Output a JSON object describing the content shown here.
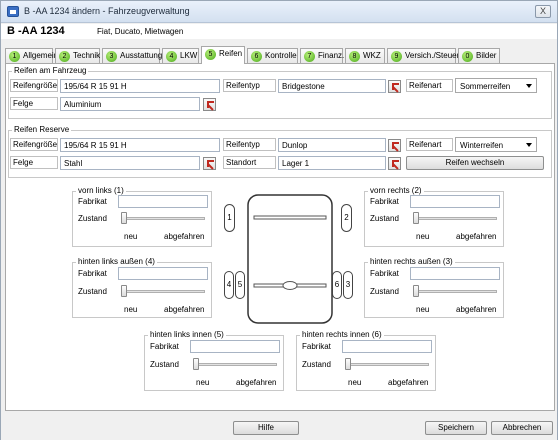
{
  "window": {
    "title": "B -AA 1234 ändern - Fahrzeugverwaltung",
    "close": "X"
  },
  "header": {
    "plate": "B -AA 1234",
    "description": "Fiat, Ducato, Mietwagen"
  },
  "tabs": [
    {
      "num": "1",
      "label": "Allgemein"
    },
    {
      "num": "2",
      "label": "Technik"
    },
    {
      "num": "3",
      "label": "Ausstattung"
    },
    {
      "num": "4",
      "label": "LKW"
    },
    {
      "num": "5",
      "label": "Reifen"
    },
    {
      "num": "6",
      "label": "Kontrolle"
    },
    {
      "num": "7",
      "label": "Finanz."
    },
    {
      "num": "8",
      "label": "WKZ"
    },
    {
      "num": "9",
      "label": "Versich./Steuer"
    },
    {
      "num": "0",
      "label": "Bilder"
    }
  ],
  "active_tab": "Reifen",
  "fahrzeug": {
    "group_title": "Reifen am Fahrzeug",
    "groesse_label": "Reifengröße",
    "groesse_value": "195/64 R 15 91 H",
    "typ_label": "Reifentyp",
    "typ_value": "Bridgestone",
    "art_label": "Reifenart",
    "art_value": "Sommerreifen",
    "felge_label": "Felge",
    "felge_value": "Aluminium"
  },
  "reserve": {
    "group_title": "Reifen Reserve",
    "groesse_label": "Reifengröße",
    "groesse_value": "195/64 R 15 91 H",
    "typ_label": "Reifentyp",
    "typ_value": "Dunlop",
    "art_label": "Reifenart",
    "art_value": "Winterreifen",
    "felge_label": "Felge",
    "felge_value": "Stahl",
    "standort_label": "Standort",
    "standort_value": "Lager 1",
    "wechseln_button": "Reifen wechseln"
  },
  "tire_common": {
    "fabrikat_label": "Fabrikat",
    "zustand_label": "Zustand",
    "neu": "neu",
    "abgefahren": "abgefahren"
  },
  "tires": {
    "vl": {
      "title": "vorn links (1)",
      "fabrikat": "",
      "zustand": 0
    },
    "vr": {
      "title": "vorn rechts (2)",
      "fabrikat": "",
      "zustand": 0
    },
    "hla": {
      "title": "hinten links außen (4)",
      "fabrikat": "",
      "zustand": 0
    },
    "hra": {
      "title": "hinten rechts außen (3)",
      "fabrikat": "",
      "zustand": 0
    },
    "hli": {
      "title": "hinten links innen (5)",
      "fabrikat": "",
      "zustand": 0
    },
    "hri": {
      "title": "hinten rechts innen (6)",
      "fabrikat": "",
      "zustand": 0
    }
  },
  "car_labels": {
    "t1": "1",
    "t2": "2",
    "t3": "3",
    "t4": "4",
    "t5": "5",
    "t6": "6"
  },
  "footer": {
    "help": "Hilfe",
    "save": "Speichern",
    "cancel": "Abbrechen"
  },
  "colors": {
    "tab_badge": "#4aaa1a",
    "pick_arrow": "#c0281e",
    "window_bg": "#f0f0f0"
  }
}
